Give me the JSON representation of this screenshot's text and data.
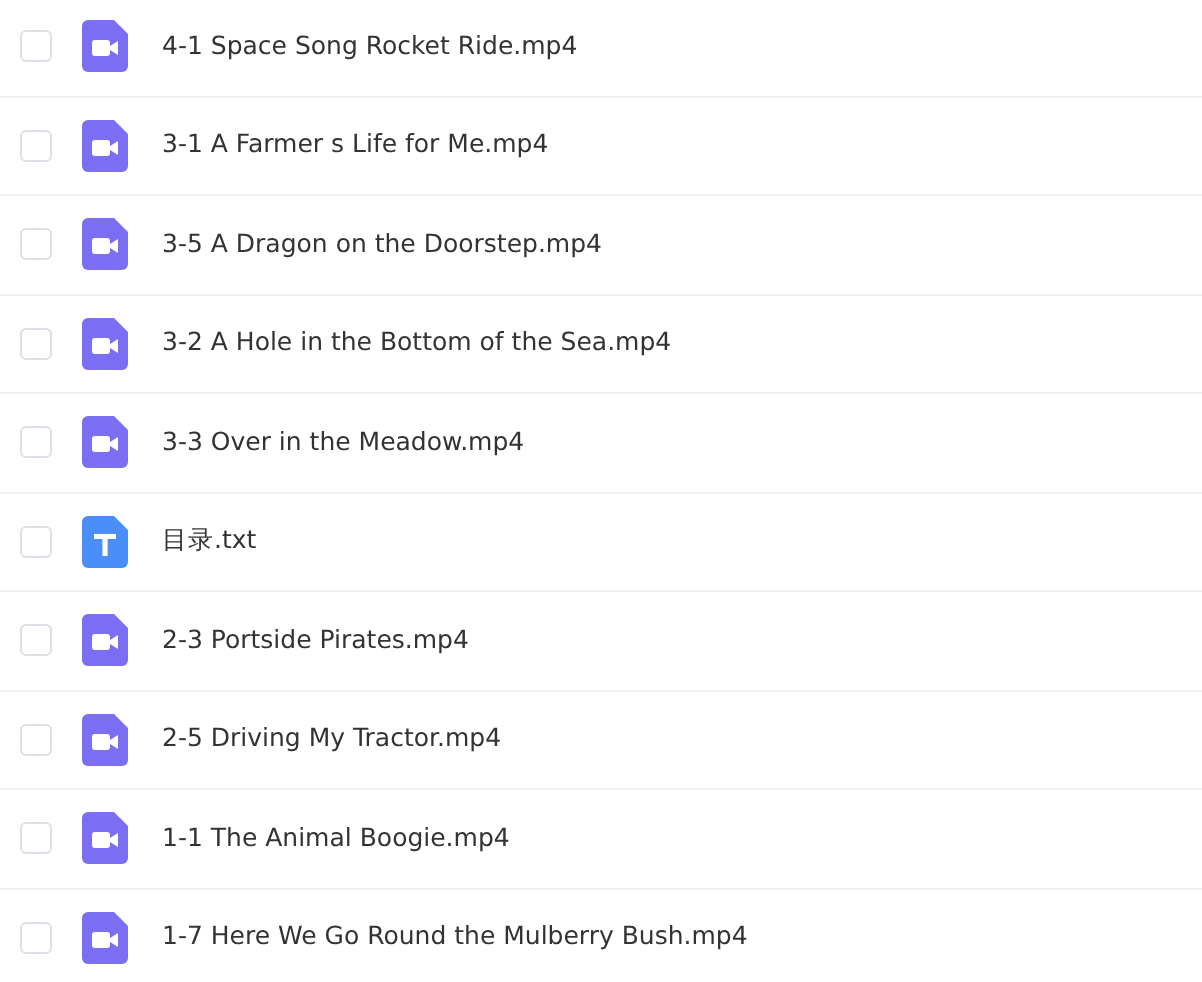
{
  "files": [
    {
      "kind": "video",
      "name": "4-1 Space Song Rocket Ride.mp4",
      "checked": false
    },
    {
      "kind": "video",
      "name": "3-1 A Farmer s Life for Me.mp4",
      "checked": false
    },
    {
      "kind": "video",
      "name": "3-5 A Dragon on the Doorstep.mp4",
      "checked": false
    },
    {
      "kind": "video",
      "name": "3-2 A Hole in the Bottom of the Sea.mp4",
      "checked": false
    },
    {
      "kind": "video",
      "name": "3-3 Over in the Meadow.mp4",
      "checked": false
    },
    {
      "kind": "text",
      "name": "目录.txt",
      "checked": false
    },
    {
      "kind": "video",
      "name": "2-3 Portside Pirates.mp4",
      "checked": false
    },
    {
      "kind": "video",
      "name": "2-5 Driving My Tractor.mp4",
      "checked": false
    },
    {
      "kind": "video",
      "name": "1-1 The Animal Boogie.mp4",
      "checked": false
    },
    {
      "kind": "video",
      "name": "1-7 Here We Go Round the Mulberry Bush.mp4",
      "checked": false
    }
  ]
}
